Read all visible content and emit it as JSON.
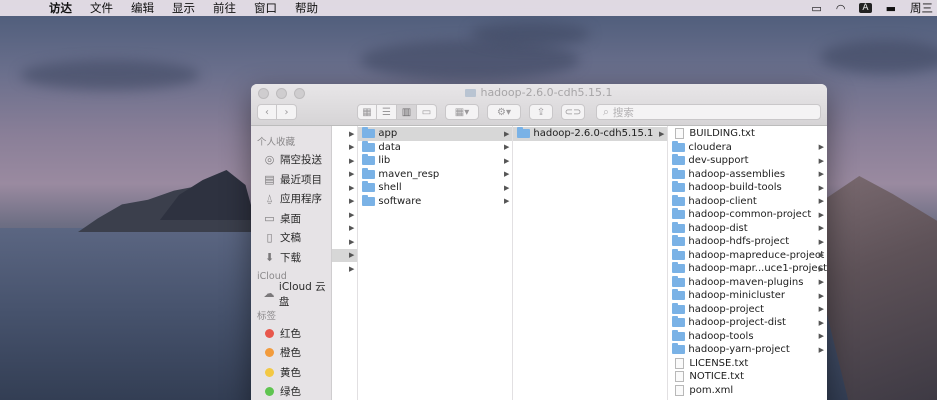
{
  "menubar": {
    "apple_glyph": "",
    "items": [
      "访达",
      "文件",
      "编辑",
      "显示",
      "前往",
      "窗口",
      "帮助"
    ],
    "input_badge": "A",
    "day": "周三"
  },
  "window": {
    "title": "hadoop-2.6.0-cdh5.15.1",
    "search_placeholder": "搜索"
  },
  "sidebar": {
    "favorites_header": "个人收藏",
    "favorites": [
      {
        "label": "隔空投送",
        "icon": "airdrop-icon"
      },
      {
        "label": "最近项目",
        "icon": "recents-icon"
      },
      {
        "label": "应用程序",
        "icon": "applications-icon"
      },
      {
        "label": "桌面",
        "icon": "desktop-icon"
      },
      {
        "label": "文稿",
        "icon": "documents-icon"
      },
      {
        "label": "下载",
        "icon": "downloads-icon"
      }
    ],
    "icloud_header": "iCloud",
    "icloud_items": [
      {
        "label": "iCloud 云盘",
        "icon": "cloud-icon"
      }
    ],
    "tags_header": "标签",
    "tags": [
      {
        "label": "红色",
        "color": "#e8574c"
      },
      {
        "label": "橙色",
        "color": "#f29b3c"
      },
      {
        "label": "黄色",
        "color": "#f3c844"
      },
      {
        "label": "绿色",
        "color": "#5fc450"
      }
    ]
  },
  "columns": {
    "col1": [
      {
        "name": "app",
        "type": "folder",
        "selected": true
      },
      {
        "name": "data",
        "type": "folder"
      },
      {
        "name": "lib",
        "type": "folder"
      },
      {
        "name": "maven_resp",
        "type": "folder"
      },
      {
        "name": "shell",
        "type": "folder"
      },
      {
        "name": "software",
        "type": "folder"
      }
    ],
    "col2": [
      {
        "name": "hadoop-2.6.0-cdh5.15.1",
        "type": "folder",
        "selected": true
      }
    ],
    "col3": [
      {
        "name": "BUILDING.txt",
        "type": "file"
      },
      {
        "name": "cloudera",
        "type": "folder"
      },
      {
        "name": "dev-support",
        "type": "folder"
      },
      {
        "name": "hadoop-assemblies",
        "type": "folder"
      },
      {
        "name": "hadoop-build-tools",
        "type": "folder"
      },
      {
        "name": "hadoop-client",
        "type": "folder"
      },
      {
        "name": "hadoop-common-project",
        "type": "folder"
      },
      {
        "name": "hadoop-dist",
        "type": "folder"
      },
      {
        "name": "hadoop-hdfs-project",
        "type": "folder"
      },
      {
        "name": "hadoop-mapreduce-project",
        "type": "folder"
      },
      {
        "name": "hadoop-mapr...uce1-project",
        "type": "folder"
      },
      {
        "name": "hadoop-maven-plugins",
        "type": "folder"
      },
      {
        "name": "hadoop-minicluster",
        "type": "folder"
      },
      {
        "name": "hadoop-project",
        "type": "folder"
      },
      {
        "name": "hadoop-project-dist",
        "type": "folder"
      },
      {
        "name": "hadoop-tools",
        "type": "folder"
      },
      {
        "name": "hadoop-yarn-project",
        "type": "folder"
      },
      {
        "name": "LICENSE.txt",
        "type": "file"
      },
      {
        "name": "NOTICE.txt",
        "type": "file"
      },
      {
        "name": "pom.xml",
        "type": "file"
      }
    ]
  }
}
